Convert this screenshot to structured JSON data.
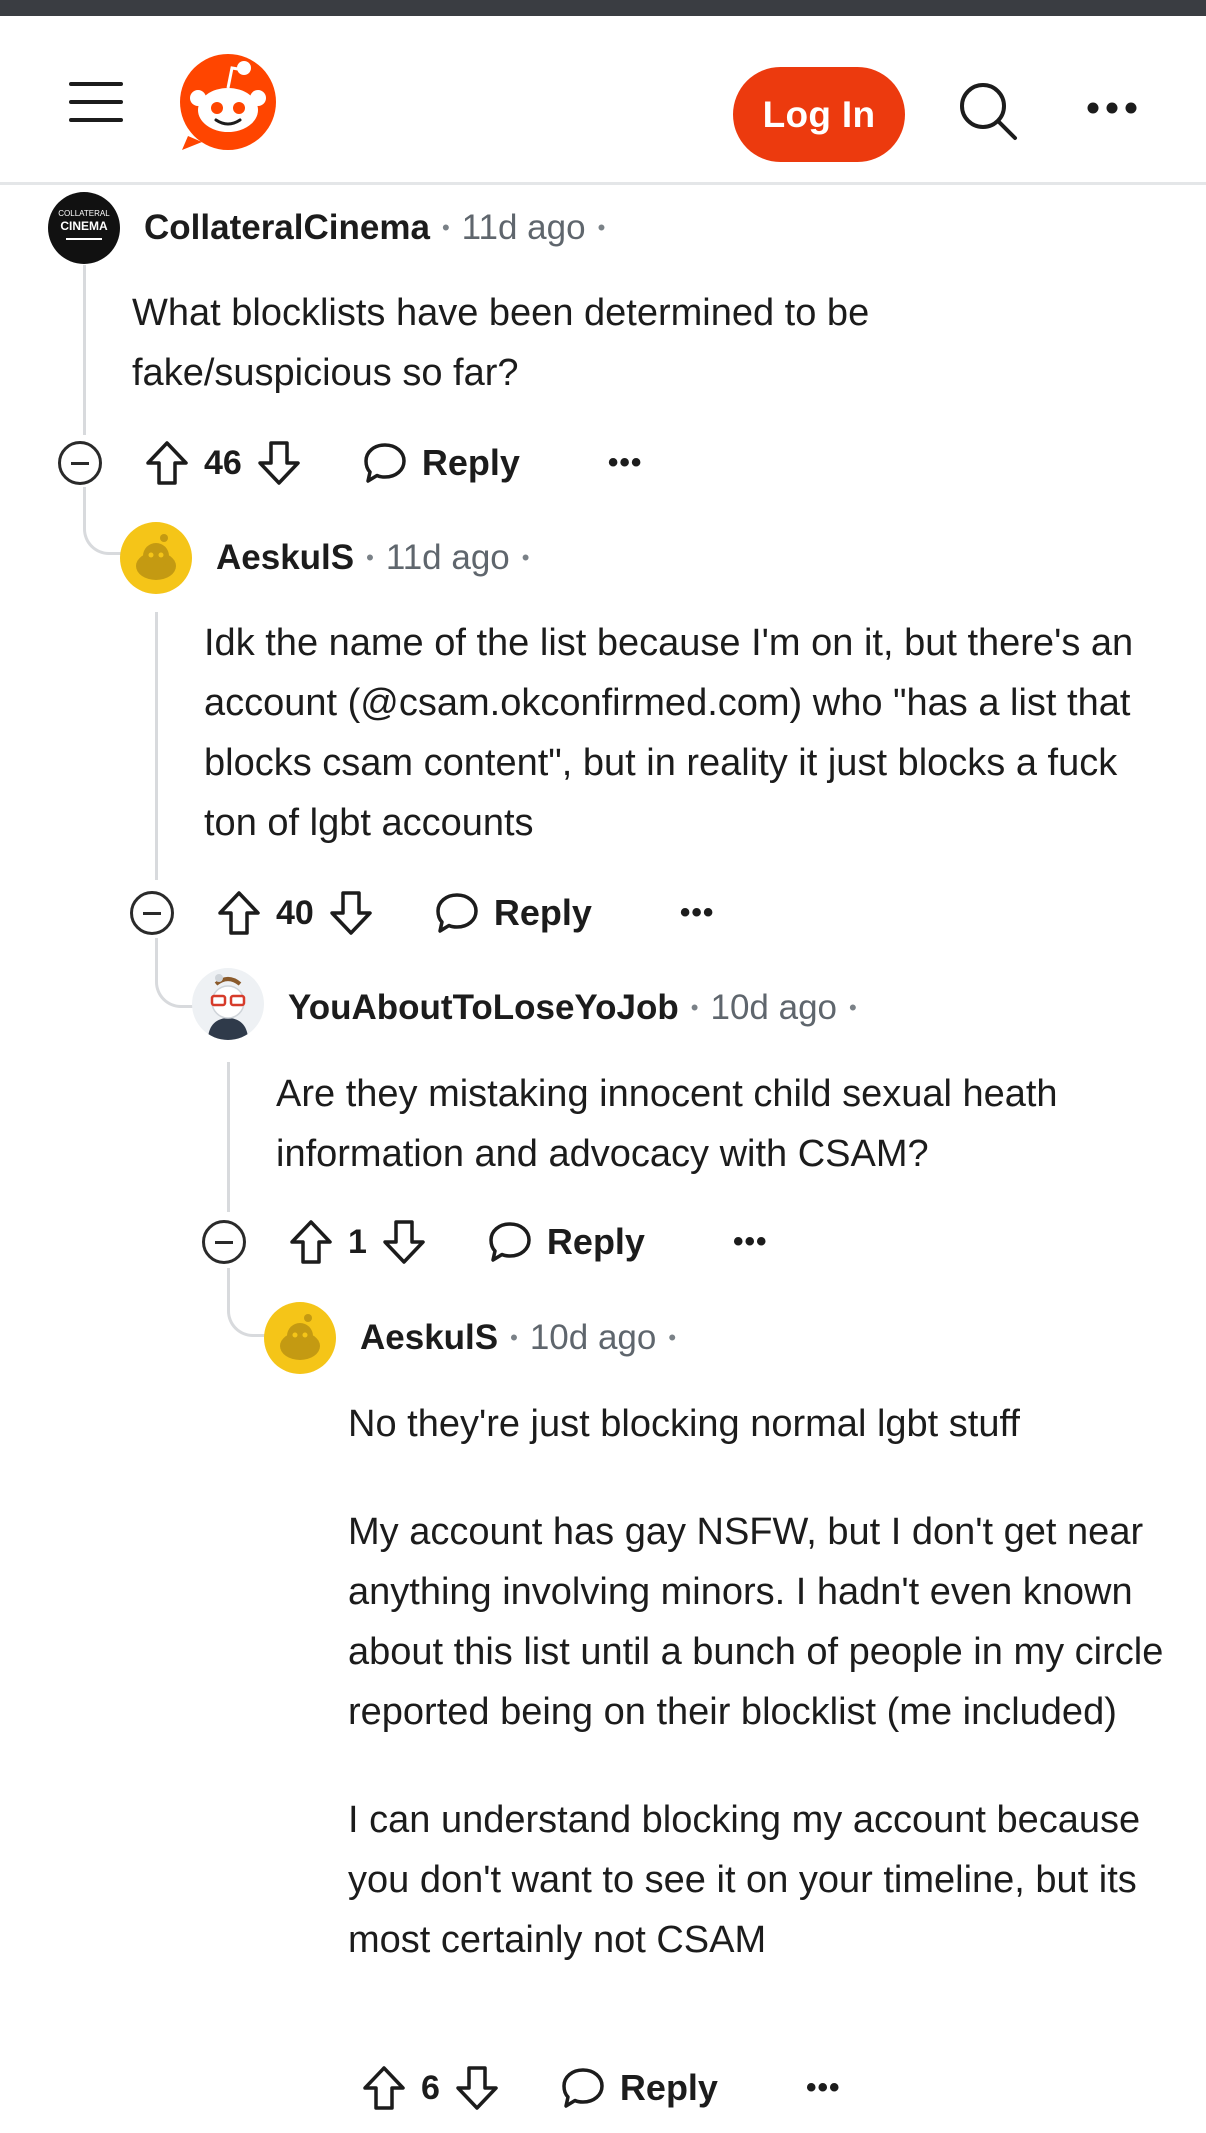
{
  "header": {
    "login_label": "Log In"
  },
  "icons": {
    "menu": "menu-icon",
    "logo": "reddit-logo-icon",
    "search": "search-icon",
    "more": "more-icon",
    "upvote": "upvote-icon",
    "downvote": "downvote-icon",
    "reply": "reply-bubble-icon",
    "collapse": "collapse-icon"
  },
  "colors": {
    "brand": "#ec3a0e",
    "thread_line": "#d8dadd",
    "snoo_yellow": "#f5c518"
  },
  "comments": [
    {
      "username": "CollateralCinema",
      "avatar_text": "COLLATERAL CINEMA",
      "time": "11d ago",
      "body": [
        "What blocklists have been determined to be fake/suspicious so far?"
      ],
      "votes": "46",
      "reply_label": "Reply",
      "more_label": "•••"
    },
    {
      "username": "AeskulS",
      "time": "11d ago",
      "body": [
        "Idk the name of the list because I'm on it, but there's an account (@csam.okconfirmed.com) who \"has a list that blocks csam content\", but in reality it just blocks a fuck ton of lgbt accounts"
      ],
      "votes": "40",
      "reply_label": "Reply",
      "more_label": "•••"
    },
    {
      "username": "YouAboutToLoseYoJob",
      "time": "10d ago",
      "body": [
        "Are they mistaking innocent child sexual heath information and advocacy with CSAM?"
      ],
      "votes": "1",
      "reply_label": "Reply",
      "more_label": "•••"
    },
    {
      "username": "AeskulS",
      "time": "10d ago",
      "body": [
        "No they're just blocking normal lgbt stuff",
        "My account has gay NSFW, but I don't get near anything involving minors. I hadn't even known about this list until a bunch of people in my circle reported being on their blocklist (me included)",
        "I can understand blocking my account because you don't want to see it on your timeline, but its most certainly not CSAM"
      ],
      "votes": "6",
      "reply_label": "Reply",
      "more_label": "•••"
    }
  ]
}
